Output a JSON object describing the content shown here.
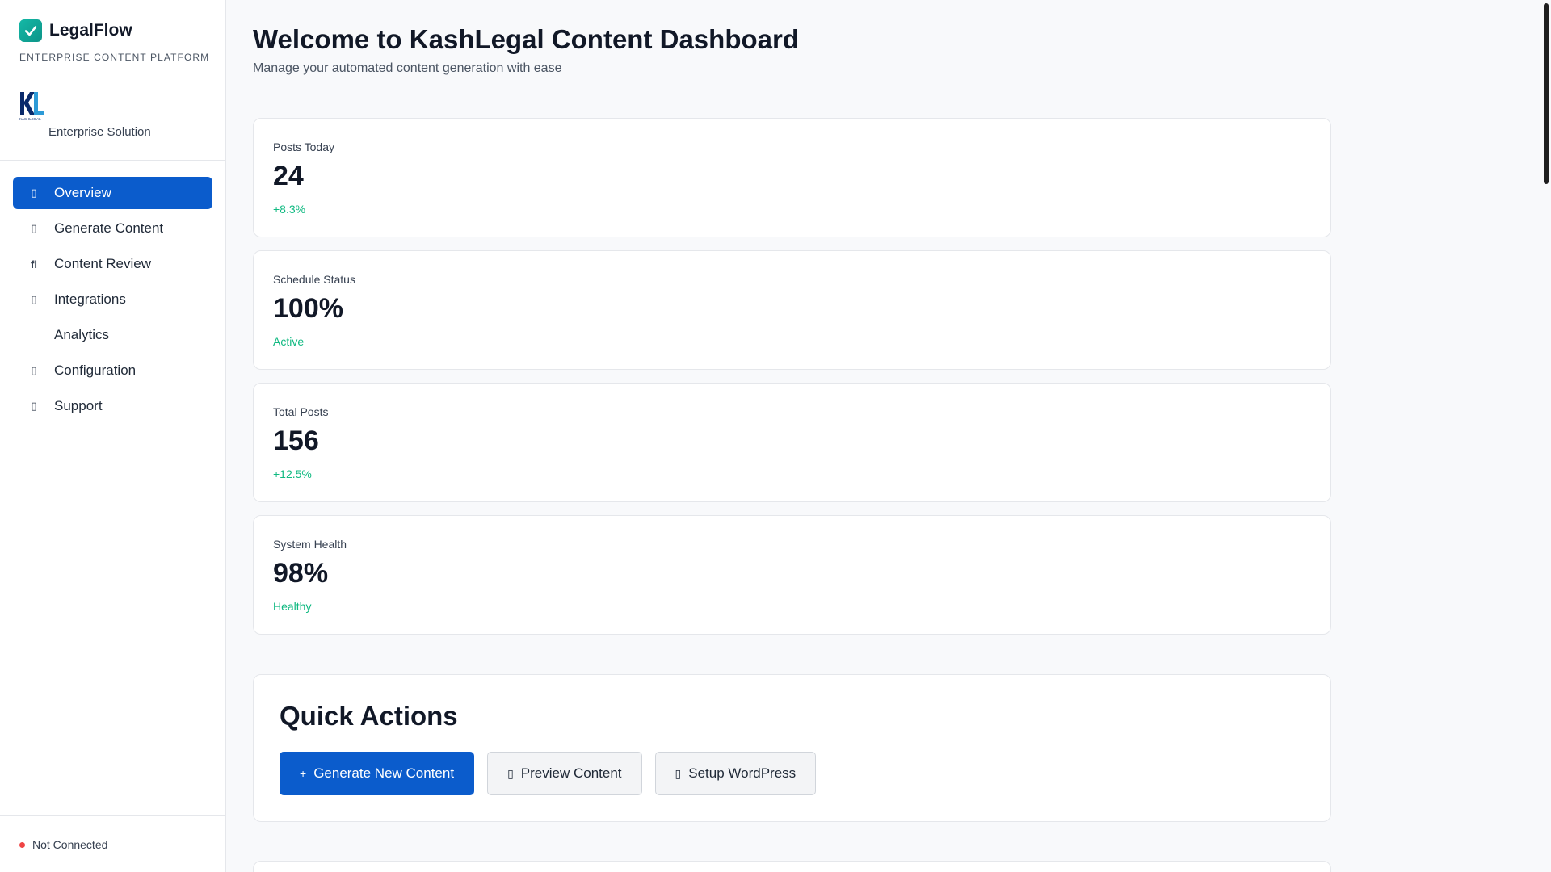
{
  "sidebar": {
    "brand_name": "LegalFlow",
    "brand_subtitle": "ENTERPRISE CONTENT PLATFORM",
    "client_subtitle": "Enterprise Solution",
    "client_logo_text": "KASHLEGAL",
    "nav_items": [
      {
        "label": "Overview",
        "icon": "grid-icon",
        "glyph": "▯",
        "active": true
      },
      {
        "label": "Generate Content",
        "icon": "pen-icon",
        "glyph": "▯",
        "active": false
      },
      {
        "label": "Content Review",
        "icon": "review-icon",
        "glyph": "ﬂ",
        "active": false
      },
      {
        "label": "Integrations",
        "icon": "plug-icon",
        "glyph": "▯",
        "active": false
      },
      {
        "label": "Analytics",
        "icon": "chart-icon",
        "glyph": "",
        "active": false
      },
      {
        "label": "Configuration",
        "icon": "gear-icon",
        "glyph": "▯",
        "active": false
      },
      {
        "label": "Support",
        "icon": "help-icon",
        "glyph": "▯",
        "active": false
      }
    ],
    "connection_status": "Not Connected",
    "connection_color": "#ef4444"
  },
  "header": {
    "title": "Welcome to KashLegal Content Dashboard",
    "subtitle": "Manage your automated content generation with ease"
  },
  "stats": [
    {
      "label": "Posts Today",
      "value": "24",
      "trend": "+8.3%"
    },
    {
      "label": "Schedule Status",
      "value": "100%",
      "trend": "Active"
    },
    {
      "label": "Total Posts",
      "value": "156",
      "trend": "+12.5%"
    },
    {
      "label": "System Health",
      "value": "98%",
      "trend": "Healthy"
    }
  ],
  "quick_actions": {
    "title": "Quick Actions",
    "buttons": [
      {
        "label": "Generate New Content",
        "icon": "plus-icon",
        "glyph": "+"
      },
      {
        "label": "Preview Content",
        "icon": "eye-icon",
        "glyph": "▯"
      },
      {
        "label": "Setup WordPress",
        "icon": "wordpress-icon",
        "glyph": "▯"
      }
    ]
  },
  "colors": {
    "accent": "#0b5ccc",
    "success": "#10b981",
    "brand": "#14b8a6"
  }
}
